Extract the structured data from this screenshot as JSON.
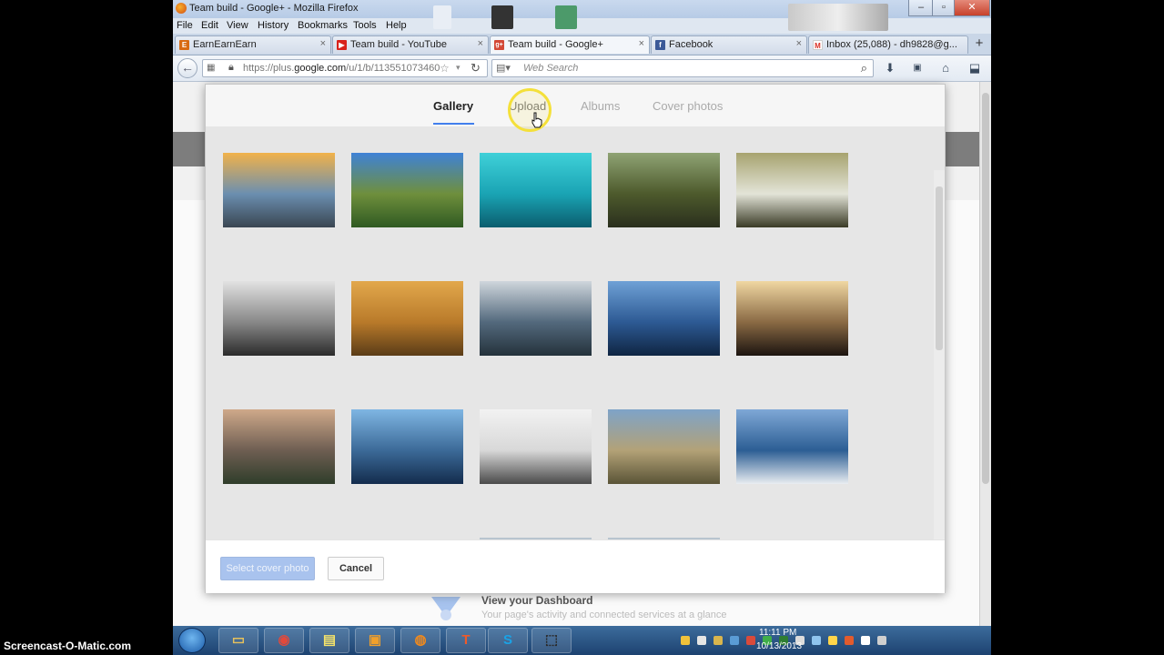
{
  "window": {
    "title": "Team build - Google+ - Mozilla Firefox",
    "controls": {
      "minimize": "–",
      "maximize": "▫",
      "close": "✕"
    }
  },
  "menu": [
    "File",
    "Edit",
    "View",
    "History",
    "Bookmarks",
    "Tools",
    "Help"
  ],
  "tabs": [
    {
      "label": "EarnEarnEarn",
      "favicon": "E",
      "color": "#d86a12",
      "active": false
    },
    {
      "label": "Team build - YouTube",
      "favicon": "▶",
      "color": "#d8221c",
      "active": false
    },
    {
      "label": "Team build - Google+",
      "favicon": "g+",
      "color": "#d34836",
      "active": true
    },
    {
      "label": "Facebook",
      "favicon": "f",
      "color": "#3b5998",
      "active": false
    },
    {
      "label": "Inbox (25,088) - dh9828@g...",
      "favicon": "M",
      "color": "#d93025",
      "active": false
    }
  ],
  "new_tab": "+",
  "address": {
    "prefix": "https://plus.",
    "domain": "google.com",
    "suffix": "/u/1/b/113551073460"
  },
  "search": {
    "placeholder": "Web Search"
  },
  "dialog": {
    "tabs": [
      "Gallery",
      "Upload",
      "Albums",
      "Cover photos"
    ],
    "active_tab": "Gallery",
    "select_button": "Select cover photo",
    "cancel_button": "Cancel"
  },
  "gallery": {
    "thumbnails": [
      {
        "name": "coastal-sunset",
        "colors": [
          "#f1b24a",
          "#6b8fb0",
          "#3a4652"
        ]
      },
      {
        "name": "green-waterfall-valley",
        "colors": [
          "#3f82d6",
          "#6f8f3c",
          "#2f5a22"
        ]
      },
      {
        "name": "teal-fiber-optics",
        "colors": [
          "#3fd0d8",
          "#1aa4b4",
          "#0b5d6e"
        ]
      },
      {
        "name": "mossy-forest-stream",
        "colors": [
          "#8fa374",
          "#4d5a2c",
          "#2a2f1d"
        ]
      },
      {
        "name": "birch-forest",
        "colors": [
          "#a7a36f",
          "#e3e4d8",
          "#3a3b26"
        ]
      },
      {
        "name": "bw-lion-landscape",
        "colors": [
          "#e2e2e2",
          "#888888",
          "#2b2b2b"
        ]
      },
      {
        "name": "golden-savanna",
        "colors": [
          "#e2a84c",
          "#b97a2a",
          "#5a3c17"
        ]
      },
      {
        "name": "lake-boathouse",
        "colors": [
          "#cfd6dc",
          "#53697d",
          "#24323b"
        ]
      },
      {
        "name": "glass-skyscraper",
        "colors": [
          "#6fa1d6",
          "#2d5a94",
          "#0f2542"
        ]
      },
      {
        "name": "night-tunnel-lights",
        "colors": [
          "#f0d7a2",
          "#8a6a44",
          "#1c1410"
        ]
      },
      {
        "name": "misty-gorge-dusk",
        "colors": [
          "#cfa98a",
          "#6e5e52",
          "#2f3d2a"
        ]
      },
      {
        "name": "city-skyline-blue",
        "colors": [
          "#7fb6e3",
          "#3c6a98",
          "#132c4d"
        ]
      },
      {
        "name": "snowy-pine-forest",
        "colors": [
          "#f2f2f2",
          "#d8d8d8",
          "#4a4a4a"
        ]
      },
      {
        "name": "elephants-grassland",
        "colors": [
          "#7ea3c8",
          "#b3a277",
          "#5a5437"
        ]
      },
      {
        "name": "snowman-lake",
        "colors": [
          "#7fa8d6",
          "#2c5e94",
          "#e9edf1"
        ]
      }
    ]
  },
  "background_page": {
    "dashboard_title": "View your Dashboard",
    "dashboard_subtitle": "Your page's activity and connected services at a glance"
  },
  "taskbar": {
    "clock_time": "11:11 PM",
    "clock_date": "10/13/2013",
    "apps": [
      {
        "name": "file-explorer-icon",
        "glyph": "▭",
        "color": "#e6c15c"
      },
      {
        "name": "chrome-icon",
        "glyph": "◉",
        "color": "#e2493b"
      },
      {
        "name": "sticky-notes-icon",
        "glyph": "▤",
        "color": "#f5e36a"
      },
      {
        "name": "hp-games-icon",
        "glyph": "▣",
        "color": "#f1a02b"
      },
      {
        "name": "firefox-icon",
        "glyph": "◍",
        "color": "#f28a1c"
      },
      {
        "name": "t-app-icon",
        "glyph": "T",
        "color": "#ef5a2a"
      },
      {
        "name": "skype-icon",
        "glyph": "S",
        "color": "#1aa3e6"
      },
      {
        "name": "screen-capture-icon",
        "glyph": "⬚",
        "color": "#2a2a2a"
      }
    ]
  },
  "watermark": "Screencast-O-Matic.com"
}
